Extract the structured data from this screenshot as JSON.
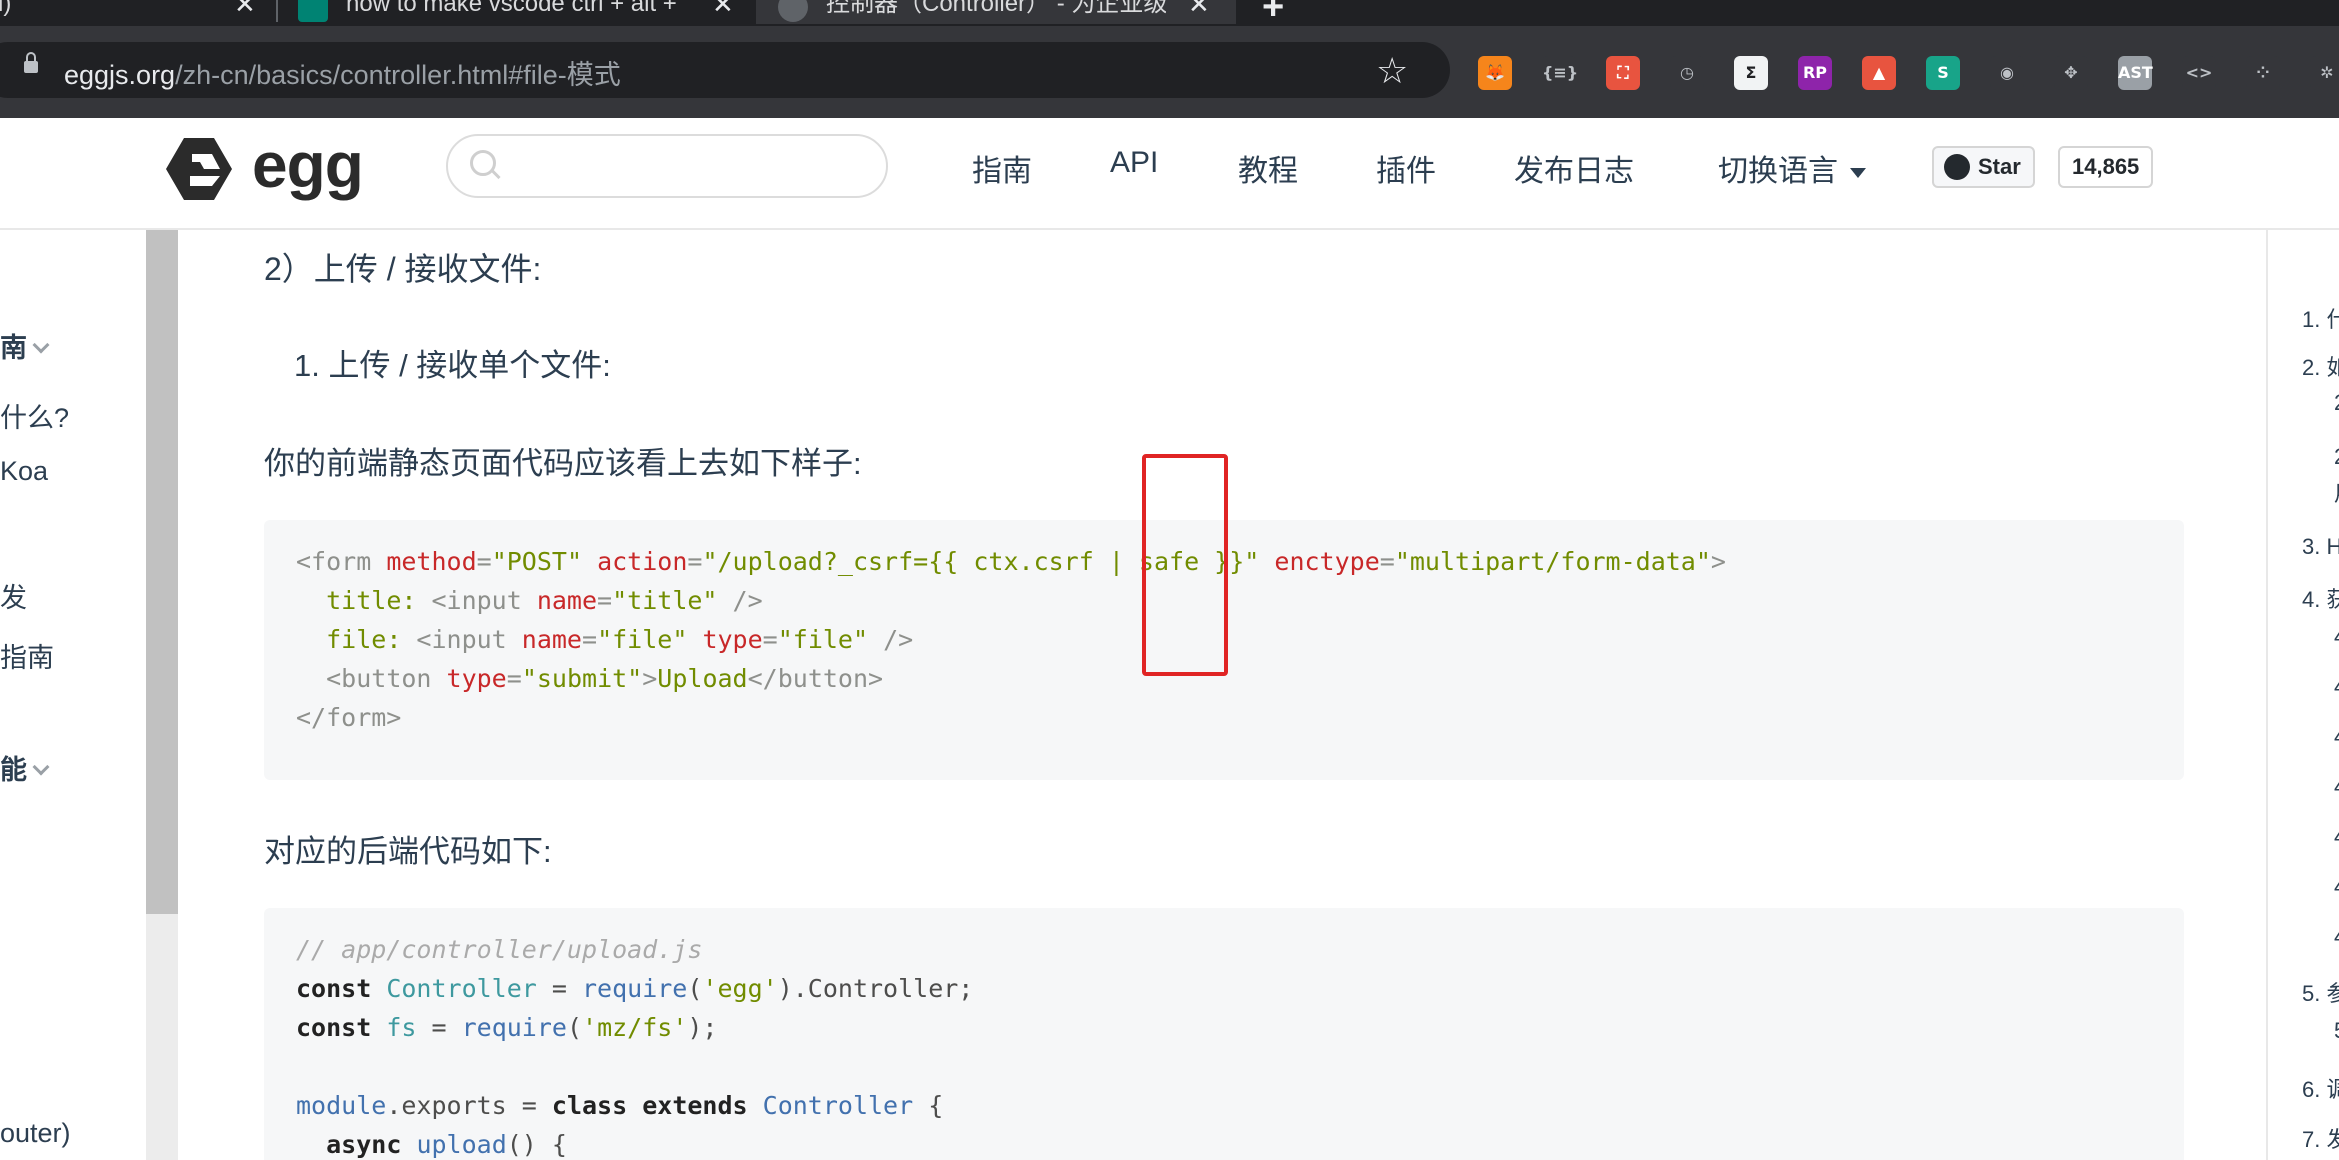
{
  "browser": {
    "tabs": [
      {
        "title": "l)",
        "active": false
      },
      {
        "title": "how to make vscode ctrl + alt + ",
        "active": false
      },
      {
        "title": "控制器（Controller） - 为企业级",
        "active": true
      }
    ],
    "tab_close_glyph": "✕",
    "new_tab_glyph": "+",
    "url_host": "eggjs.org",
    "url_path": "/zh-cn/basics/controller.html#file-模式",
    "bookmark_glyph": "☆",
    "extensions": [
      {
        "name": "metamask-extension-icon",
        "label": "🦊",
        "color": "#f6851b"
      },
      {
        "name": "json-extension-icon",
        "label": "{≡}",
        "color": "#35363a"
      },
      {
        "name": "sitemap-extension-icon",
        "label": "⛶",
        "color": "#e8543f"
      },
      {
        "name": "clock-extension-icon",
        "label": "◷",
        "color": "#35363a"
      },
      {
        "name": "terminal-extension-icon",
        "label": "Σ",
        "color": "#f1f3f4"
      },
      {
        "name": "rp-extension-icon",
        "label": "RP",
        "color": "#8e24aa"
      },
      {
        "name": "rocket-extension-icon",
        "label": "▲",
        "color": "#e8543f"
      },
      {
        "name": "s-extension-icon",
        "label": "S",
        "color": "#18a489"
      },
      {
        "name": "github-extension-icon",
        "label": "◉",
        "color": "#35363a"
      },
      {
        "name": "puzzle-extension-icon",
        "label": "✥",
        "color": "#35363a"
      },
      {
        "name": "ast-extension-icon",
        "label": "AST",
        "color": "#9aa0a6"
      },
      {
        "name": "code-extension-icon",
        "label": "<>",
        "color": "#35363a"
      },
      {
        "name": "dots-extension-icon",
        "label": "⁘",
        "color": "#35363a"
      },
      {
        "name": "gear-extension-icon",
        "label": "✲",
        "color": "#35363a"
      }
    ]
  },
  "site": {
    "logo_text": "egg",
    "search_placeholder": "",
    "nav": [
      "指南",
      "API",
      "教程",
      "插件",
      "发布日志",
      "切换语言"
    ],
    "github_star_label": "Star",
    "github_star_count": "14,865"
  },
  "left_sidebar": {
    "items": [
      "南",
      "什么?",
      "Koa",
      "发",
      "指南",
      "能",
      "outer)"
    ]
  },
  "content": {
    "step_heading": "2）上传 / 接收文件:",
    "list_item": "1. 上传 / 接收单个文件:",
    "frontend_intro": "你的前端静态页面代码应该看上去如下样子:",
    "backend_intro": "对应的后端代码如下:"
  },
  "right_toc": {
    "items": [
      "1. 什",
      "2. 如",
      "2",
      "2",
      "用",
      "3. H",
      "4. 获",
      "4",
      "4",
      "4",
      "4",
      "4",
      "4",
      "4",
      "5. 参",
      "5",
      "6. 调",
      "7. 发"
    ]
  },
  "colors": {
    "chrome_dark": "#202124",
    "chrome_toolbar": "#35363a",
    "code_bg": "#f6f7f8",
    "annotation_red": "#e02424"
  }
}
